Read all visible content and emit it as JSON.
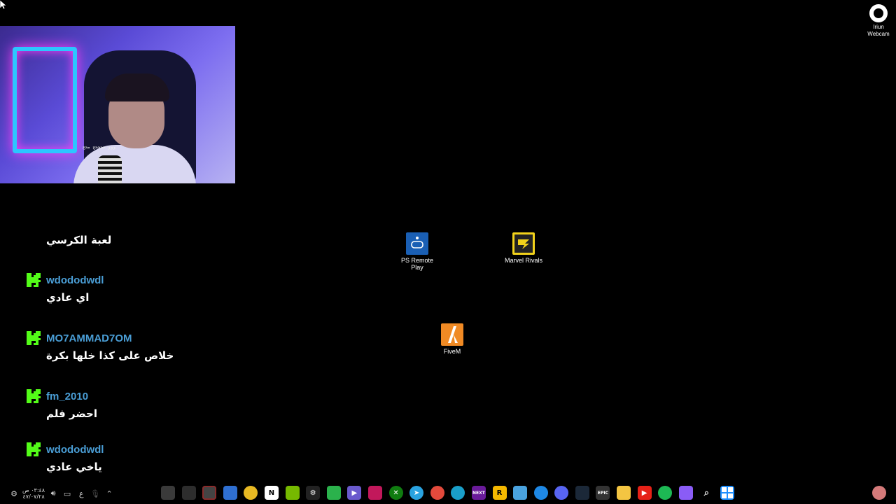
{
  "webcam": {
    "overlay_text": "ووو ححححح محح"
  },
  "chat": {
    "messages": [
      {
        "user": "",
        "text": "لعبة الكرسي"
      },
      {
        "user": "wdododwdl",
        "text": "اي عادي"
      },
      {
        "user": "MO7AMMAD7OM",
        "text": "خلاص على كذا خلها بكرة"
      },
      {
        "user": "fm_2010",
        "text": "احضر فلم"
      },
      {
        "user": "wdododwdl",
        "text": "ياخي عادي"
      }
    ],
    "username_color": "#4a9ed6",
    "badge_color": "#53fc18"
  },
  "desktop": {
    "icons": [
      {
        "label_line1": "PS Remote",
        "label_line2": "Play",
        "icon": "ps-remote-play-icon",
        "color": "#1a5fb4"
      },
      {
        "label_line1": "Marvel Rivals",
        "label_line2": "",
        "icon": "marvel-rivals-icon",
        "color": "#f2d21b"
      },
      {
        "label_line1": "FiveM",
        "label_line2": "",
        "icon": "fivem-icon",
        "color": "#f08a24"
      }
    ],
    "iriun": {
      "line1": "Iriun",
      "line2": "Webcam"
    }
  },
  "taskbar": {
    "clock_time": "٠٣:٤٨ ص",
    "clock_date": "٤٧/٠٧/٢٨",
    "lang": "ع",
    "apps": [
      {
        "icon": "ring-app-icon",
        "color": "#3a3a3a"
      },
      {
        "icon": "steelseries-icon",
        "color": "#2d2d2d"
      },
      {
        "icon": "obs-icon",
        "color": "#444"
      },
      {
        "icon": "browser-folder-icon",
        "color": "#2f6fd1"
      },
      {
        "icon": "chrome-icon",
        "color": "#e8b923"
      },
      {
        "icon": "notion-icon",
        "color": "#ffffff"
      },
      {
        "icon": "nvidia-icon",
        "color": "#76b900"
      },
      {
        "icon": "steam-gear-icon",
        "color": "#222"
      },
      {
        "icon": "wechat-icon",
        "color": "#2bb24c"
      },
      {
        "icon": "video-app-icon",
        "color": "#6a5acd"
      },
      {
        "icon": "app-grid-icon",
        "color": "#c2185b"
      },
      {
        "icon": "xbox-icon",
        "color": "#107c10"
      },
      {
        "icon": "telegram-icon",
        "color": "#2aa3e0"
      },
      {
        "icon": "photos-icon",
        "color": "#e34a3c"
      },
      {
        "icon": "edge-icon",
        "color": "#1a9fc9"
      },
      {
        "icon": "next-app-icon",
        "color": "#6a1b9a"
      },
      {
        "icon": "rockstar-icon",
        "color": "#f5b800"
      },
      {
        "icon": "monitor-app-icon",
        "color": "#4aa3df"
      },
      {
        "icon": "battlenet-icon",
        "color": "#1e88e5"
      },
      {
        "icon": "discord-icon",
        "color": "#5865f2"
      },
      {
        "icon": "steam-icon",
        "color": "#1b2838"
      },
      {
        "icon": "epic-games-icon",
        "color": "#333"
      },
      {
        "icon": "file-explorer-icon",
        "color": "#f4c542"
      },
      {
        "icon": "youtube-icon",
        "color": "#e62117"
      },
      {
        "icon": "spotify-icon",
        "color": "#1db954"
      },
      {
        "icon": "copilot-icon",
        "color": "#8a5cf6"
      },
      {
        "icon": "search-icon",
        "color": "#000"
      },
      {
        "icon": "windows-start-icon",
        "color": "#1e90ff"
      }
    ],
    "app_labels": [
      "",
      "",
      "",
      "",
      "",
      "",
      "",
      "",
      "",
      "",
      "",
      "",
      "",
      "",
      "",
      "NEXT",
      "",
      "",
      "",
      "",
      "",
      "EPIC",
      "",
      "",
      "",
      "",
      "",
      ""
    ]
  }
}
